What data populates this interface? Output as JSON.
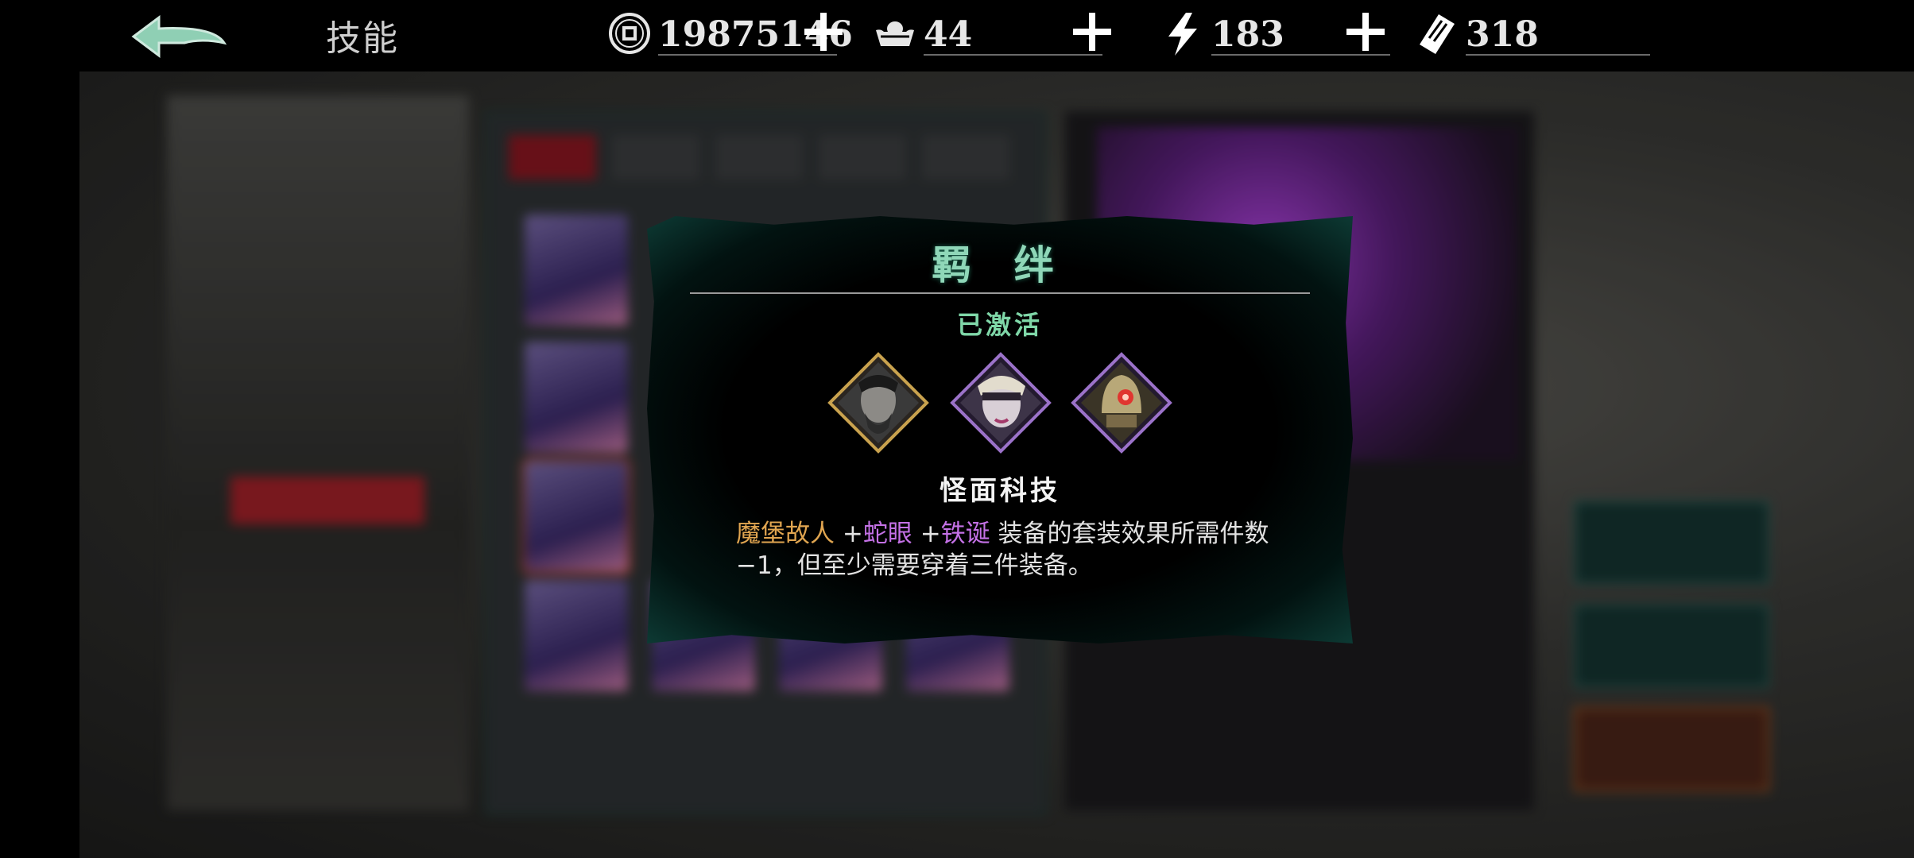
{
  "header": {
    "title": "技能",
    "resources": [
      {
        "name": "copper-coin",
        "value": "19875146"
      },
      {
        "name": "silver-ingot",
        "value": "44"
      },
      {
        "name": "energy",
        "value": "183"
      },
      {
        "name": "ticket",
        "value": "318"
      }
    ]
  },
  "popup": {
    "title": "羁 绊",
    "status": "已激活",
    "set_name": "怪面科技",
    "members": [
      {
        "name": "魔堡故人",
        "color": "#e0a550"
      },
      {
        "name": "蛇眼",
        "color": "#c471e6"
      },
      {
        "name": "铁诞",
        "color": "#c471e6"
      }
    ],
    "plus_1": " +",
    "plus_2": " +",
    "effect_text": " 装备的套装效果所需件数−1，但至少需要穿着三件装备。"
  },
  "colors": {
    "accent_green": "#8fd7b8",
    "status_green": "#7fd7a8",
    "gold": "#e0a550",
    "purple": "#c471e6",
    "active_red": "#a12028"
  }
}
